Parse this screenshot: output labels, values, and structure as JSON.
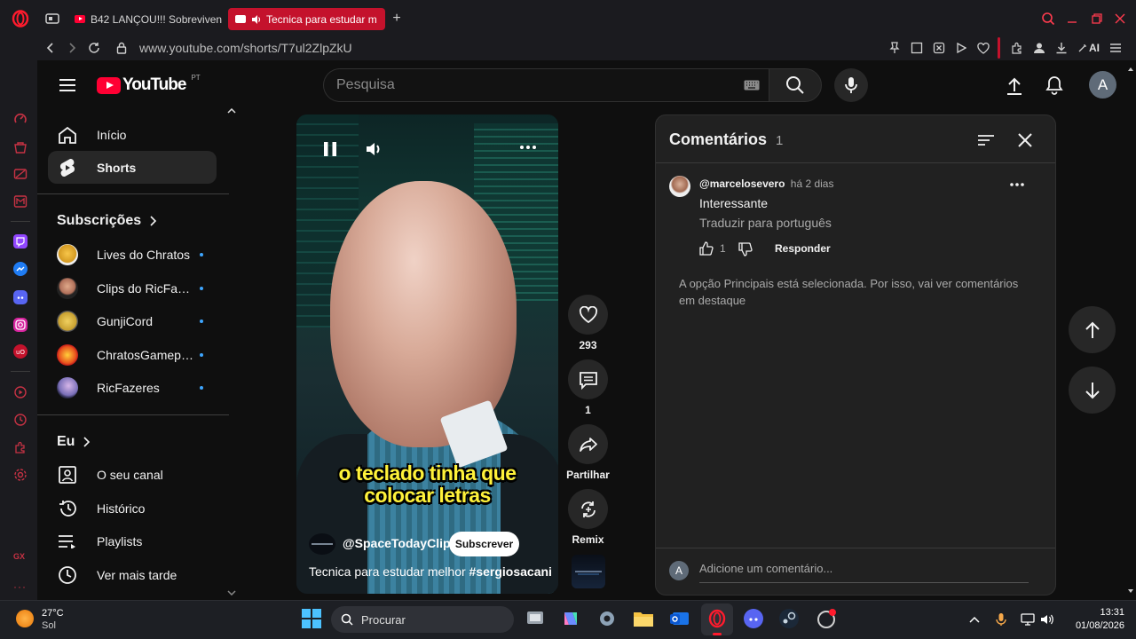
{
  "browser": {
    "tabs": [
      {
        "title": "B42 LANÇOU!!! Sobreviven"
      },
      {
        "title": "Tecnica para estudar m"
      }
    ],
    "url": "www.youtube.com/shorts/T7ul2ZlpZkU",
    "ai_label": "AI"
  },
  "youtube": {
    "logo_text": "YouTube",
    "logo_country": "PT",
    "search_placeholder": "Pesquisa",
    "account_initial": "A",
    "nav": [
      {
        "label": "Início"
      },
      {
        "label": "Shorts"
      }
    ],
    "subscriptions_title": "Subscrições",
    "subscriptions": [
      {
        "label": "Lives do Chratos"
      },
      {
        "label": "Clips do RicFaze..."
      },
      {
        "label": "GunjiCord"
      },
      {
        "label": "ChratosGameplay"
      },
      {
        "label": "RicFazeres"
      }
    ],
    "you_title": "Eu",
    "you_items": [
      {
        "label": "O seu canal"
      },
      {
        "label": "Histórico"
      },
      {
        "label": "Playlists"
      },
      {
        "label": "Ver mais tarde"
      }
    ]
  },
  "short": {
    "caption_line1": "o teclado tinha que",
    "caption_line2": "colocar letras",
    "channel": "@SpaceTodayClips",
    "subscribe_label": "Subscrever",
    "title": "Tecnica para estudar melhor",
    "hashtag": "#sergiosacani",
    "likes": "293",
    "comments_count": "1",
    "share_label": "Partilhar",
    "remix_label": "Remix"
  },
  "comments": {
    "title": "Comentários",
    "count": "1",
    "items": [
      {
        "author": "@marcelosevero",
        "time": "há 2 dias",
        "text": "Interessante",
        "translate": "Traduzir para português",
        "likes": "1",
        "reply_label": "Responder"
      }
    ],
    "notice": "A opção Principais está selecionada. Por isso, vai ver comentários em destaque",
    "add_placeholder": "Adicione um comentário...",
    "user_initial": "A"
  },
  "taskbar": {
    "temp": "27°C",
    "weather": "Sol",
    "search_label": "Procurar",
    "time": "13:31",
    "date": "01/08/2026"
  },
  "colors": {
    "accent": "#3ea6ff",
    "opera_red": "#ff1b2d",
    "youtube_red": "#ff0033",
    "caption_yellow": "#fff23a"
  }
}
